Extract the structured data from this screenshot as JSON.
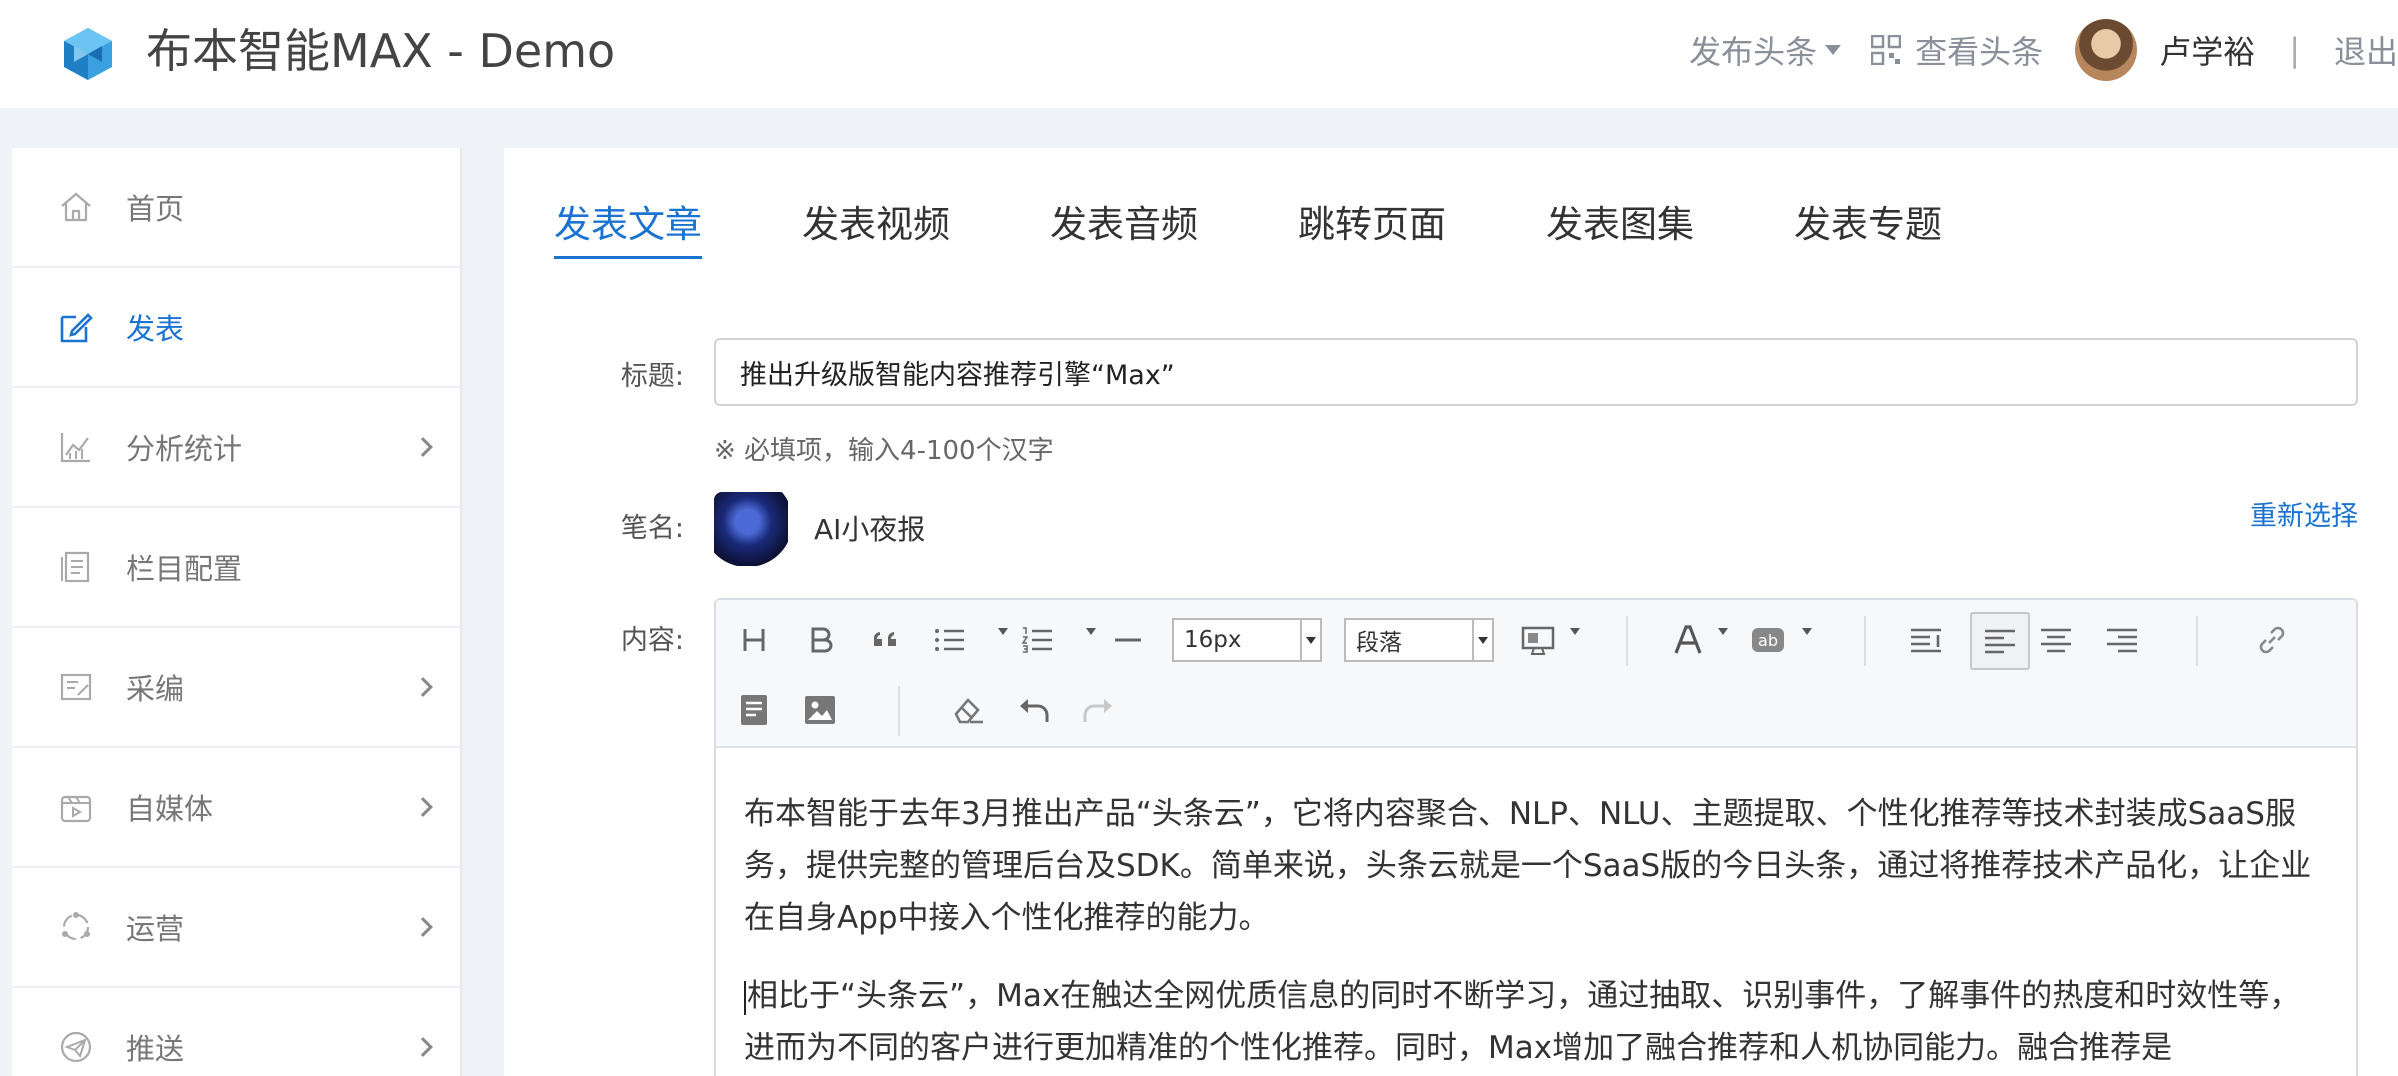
{
  "header": {
    "app_title": "布本智能MAX - Demo",
    "publish_menu": "发布头条",
    "view_link": "查看头条",
    "user_name": "卢学裕",
    "separator": "|",
    "logout": "退出"
  },
  "sidebar": {
    "items": [
      {
        "label": "首页",
        "icon": "home-icon",
        "active": false,
        "has_arrow": false
      },
      {
        "label": "发表",
        "icon": "edit-icon",
        "active": true,
        "has_arrow": false
      },
      {
        "label": "分析统计",
        "icon": "chart-icon",
        "active": false,
        "has_arrow": true
      },
      {
        "label": "栏目配置",
        "icon": "column-config-icon",
        "active": false,
        "has_arrow": false
      },
      {
        "label": "采编",
        "icon": "collect-icon",
        "active": false,
        "has_arrow": true
      },
      {
        "label": "自媒体",
        "icon": "media-icon",
        "active": false,
        "has_arrow": true
      },
      {
        "label": "运营",
        "icon": "operation-icon",
        "active": false,
        "has_arrow": true
      },
      {
        "label": "推送",
        "icon": "push-icon",
        "active": false,
        "has_arrow": true
      }
    ]
  },
  "tabs": [
    {
      "label": "发表文章",
      "active": true
    },
    {
      "label": "发表视频",
      "active": false
    },
    {
      "label": "发表音频",
      "active": false
    },
    {
      "label": "跳转页面",
      "active": false
    },
    {
      "label": "发表图集",
      "active": false
    },
    {
      "label": "发表专题",
      "active": false
    }
  ],
  "form": {
    "title_label": "标题:",
    "title_value": "推出升级版智能内容推荐引擎“Max”",
    "title_hint": "※ 必填项，输入4-100个汉字",
    "pen_label": "笔名:",
    "pen_name": "AI小夜报",
    "reselect": "重新选择",
    "content_label": "内容:"
  },
  "editor": {
    "font_size": "16px",
    "paragraph": "段落",
    "paragraphs": [
      "布本智能于去年3月推出产品“头条云”，它将内容聚合、NLP、NLU、主题提取、个性化推荐等技术封装成SaaS服务，提供完整的管理后台及SDK。简单来说，头条云就是一个SaaS版的今日头条，通过将推荐技术产品化，让企业在自身App中接入个性化推荐的能力。",
      "相比于“头条云”，Max在触达全网优质信息的同时不断学习，通过抽取、识别事件，了解事件的热度和时效性等，进而为不同的客户进行更加精准的个性化推荐。同时，Max增加了融合推荐和人机协同能力。融合推荐是"
    ]
  },
  "colors": {
    "accent": "#1a73d0",
    "background": "#eff3f8"
  }
}
